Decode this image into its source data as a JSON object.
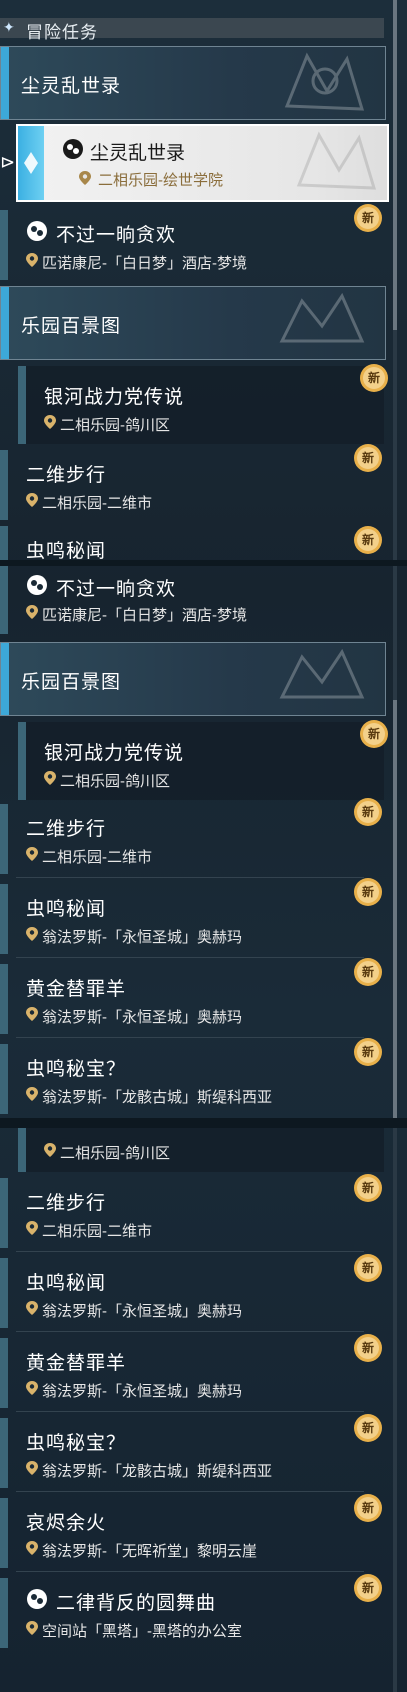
{
  "header": {
    "title": "冒险任务"
  },
  "badge_label": "新",
  "section1": {
    "category_title": "尘灵乱世录",
    "selected_task": {
      "name": "尘灵乱世录",
      "location": "二相乐园-绘世学院"
    },
    "task_a": {
      "name": "不过一晌贪欢",
      "location": "匹诺康尼-「白日梦」酒店-梦境"
    },
    "category2_title": "乐园百景图",
    "sub_task": {
      "name": "银河战力党传说",
      "location": "二相乐园-鸽川区"
    },
    "task_b": {
      "name": "二维步行",
      "location": "二相乐园-二维市"
    },
    "task_c_partial": {
      "name": "虫鸣秘闻"
    }
  },
  "section2": {
    "task_a": {
      "name": "不过一晌贪欢",
      "location": "匹诺康尼-「白日梦」酒店-梦境"
    },
    "category_title": "乐园百景图",
    "sub_task": {
      "name": "银河战力党传说",
      "location": "二相乐园-鸽川区"
    },
    "tasks": [
      {
        "name": "二维步行",
        "location": "二相乐园-二维市"
      },
      {
        "name": "虫鸣秘闻",
        "location": "翁法罗斯-「永恒圣城」奥赫玛"
      },
      {
        "name": "黄金替罪羊",
        "location": "翁法罗斯-「永恒圣城」奥赫玛"
      },
      {
        "name": "虫鸣秘宝？",
        "location": "翁法罗斯-「龙骸古城」斯缇科西亚"
      }
    ]
  },
  "section3": {
    "sub_location": "二相乐园-鸽川区",
    "tasks": [
      {
        "name": "二维步行",
        "location": "二相乐园-二维市"
      },
      {
        "name": "虫鸣秘闻",
        "location": "翁法罗斯-「永恒圣城」奥赫玛"
      },
      {
        "name": "黄金替罪羊",
        "location": "翁法罗斯-「永恒圣城」奥赫玛"
      },
      {
        "name": "虫鸣秘宝？",
        "location": "翁法罗斯-「龙骸古城」斯缇科西亚"
      },
      {
        "name": "哀烬余火",
        "location": "翁法罗斯-「无晖祈堂」黎明云崖"
      },
      {
        "name": "二律背反的圆舞曲",
        "location": "空间站「黑塔」-黑塔的办公室"
      }
    ]
  },
  "colors": {
    "accent": "#3da8d8",
    "badge": "#e8b04a",
    "location_selected": "#8a6d3b"
  }
}
